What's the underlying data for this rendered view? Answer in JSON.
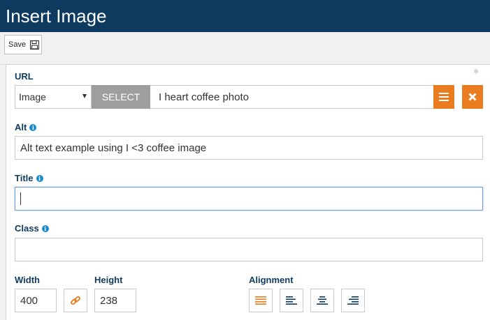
{
  "header": {
    "title": "Insert Image"
  },
  "toolbar": {
    "save_label": "Save"
  },
  "form": {
    "url": {
      "label": "URL",
      "type_select_value": "Image",
      "select_button_label": "SELECT",
      "value": "I heart coffee photo"
    },
    "alt": {
      "label": "Alt",
      "value": "Alt text example using I <3 coffee image"
    },
    "title": {
      "label": "Title",
      "value": ""
    },
    "class": {
      "label": "Class",
      "value": ""
    },
    "width": {
      "label": "Width",
      "value": "400"
    },
    "height": {
      "label": "Height",
      "value": "238"
    },
    "alignment": {
      "label": "Alignment",
      "options": [
        "justify",
        "left",
        "center",
        "right"
      ],
      "selected": "justify"
    }
  },
  "colors": {
    "header_bg": "#0e3a5f",
    "label": "#0e3a5f",
    "accent_orange": "#e87c1e",
    "info_blue": "#1a8ccc",
    "select_button_bg": "#9e9e9e"
  },
  "icons": {
    "save": "floppy-disk-icon",
    "menu": "hamburger-icon",
    "clear": "close-icon",
    "info": "info-icon",
    "link": "chain-link-icon",
    "align_justify": "align-justify-icon",
    "align_left": "align-left-icon",
    "align_center": "align-center-icon",
    "align_right": "align-right-icon"
  }
}
